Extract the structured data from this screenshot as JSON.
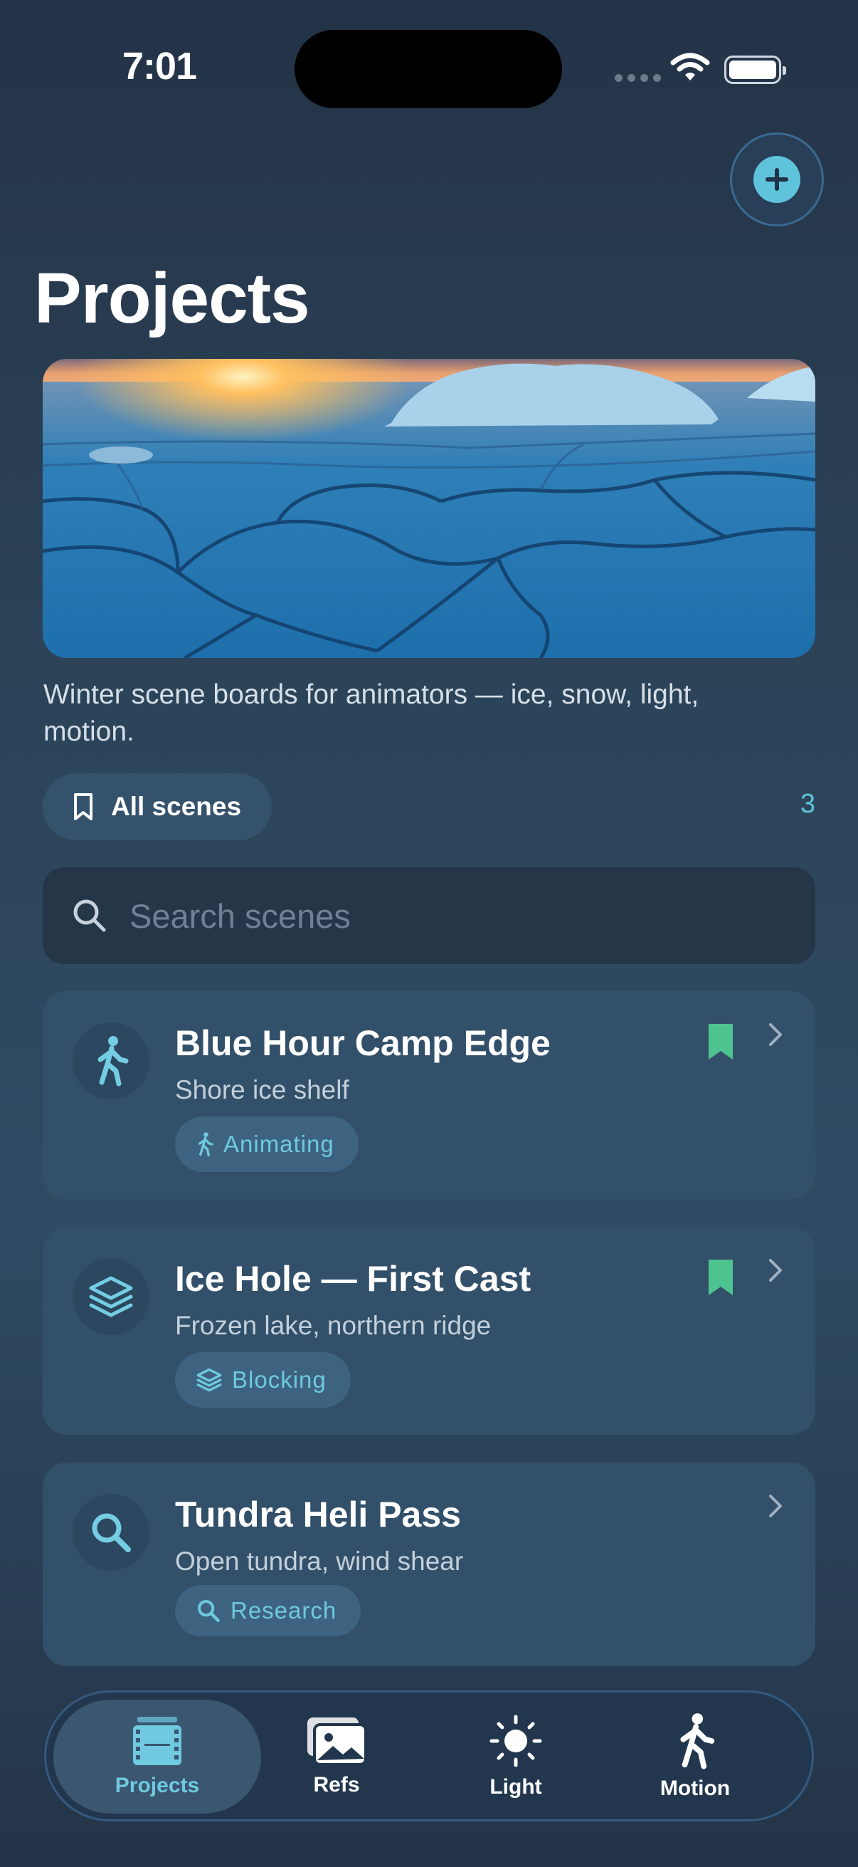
{
  "status_bar": {
    "time": "7:01"
  },
  "header": {
    "title": "Projects",
    "add_button_icon": "plus-icon"
  },
  "description": "Winter scene boards for animators — ice, snow, light, motion.",
  "filter": {
    "label": "All scenes",
    "icon": "bookmark-icon",
    "count": "3"
  },
  "search": {
    "placeholder": "Search scenes",
    "icon": "search-icon"
  },
  "scenes": [
    {
      "title": "Blue Hour Camp Edge",
      "subtitle": "Shore ice shelf",
      "tag": "Animating",
      "icon": "walking-figure-icon",
      "bookmarked": true
    },
    {
      "title": "Ice Hole — First Cast",
      "subtitle": "Frozen lake, northern ridge",
      "tag": "Blocking",
      "icon": "layers-icon",
      "bookmarked": true
    },
    {
      "title": "Tundra Heli Pass",
      "subtitle": "Open tundra, wind shear",
      "tag": "Research",
      "icon": "search-icon",
      "bookmarked": false
    }
  ],
  "tabbar": {
    "active": "Projects",
    "tabs": [
      {
        "label": "Projects",
        "icon": "film-icon"
      },
      {
        "label": "Refs",
        "icon": "photos-icon"
      },
      {
        "label": "Light",
        "icon": "sun-icon"
      },
      {
        "label": "Motion",
        "icon": "walking-figure-icon"
      }
    ]
  },
  "colors": {
    "accent": "#5ec3db",
    "bookmark": "#4fc38f",
    "card": "#325069",
    "background": "#2c4358"
  }
}
